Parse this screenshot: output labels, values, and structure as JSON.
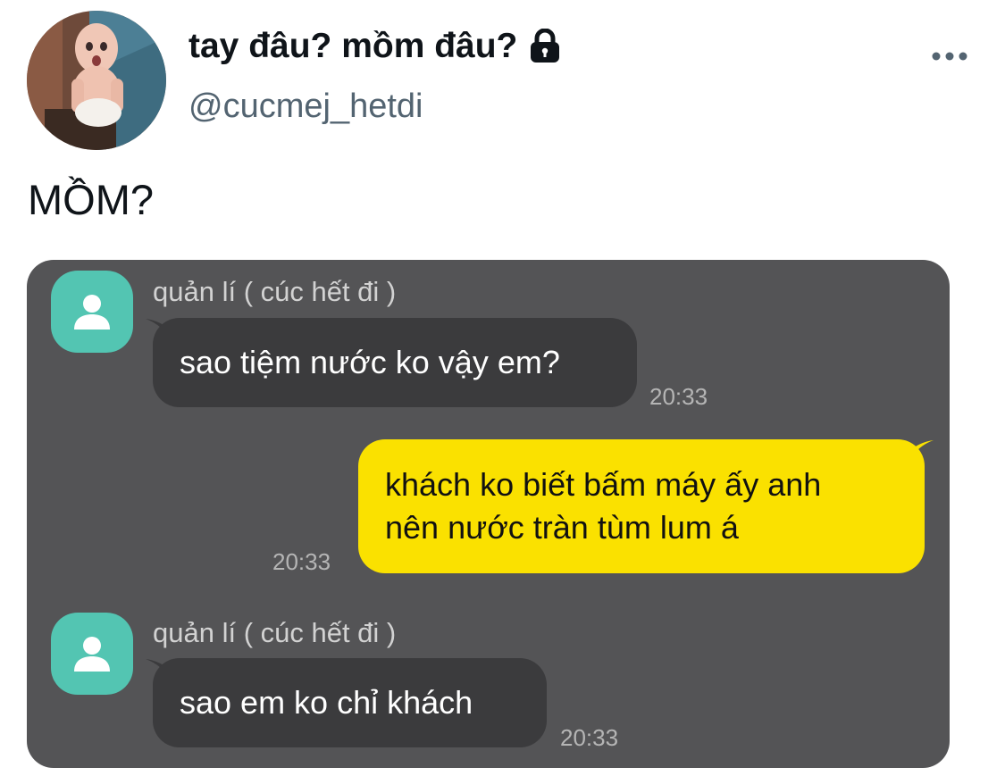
{
  "tweet": {
    "display_name": "tay đâu? mồm đâu?",
    "handle": "@cucmej_hetdi",
    "locked": true,
    "text": "MỒM?"
  },
  "icons": {
    "lock": "lock-icon",
    "more": "more-horizontal-icon",
    "avatar_placeholder": "person-icon"
  },
  "colors": {
    "chat_background": "#545456",
    "incoming_bubble": "#3b3b3d",
    "outgoing_bubble": "#fae100",
    "chat_avatar": "#53c5b2",
    "handle_text": "#536471"
  },
  "chat": {
    "messages": [
      {
        "sender": "quản lí ( cúc hết đi )",
        "direction": "incoming",
        "lines": [
          "sao tiệm nước ko vậy em?"
        ],
        "time": "20:33"
      },
      {
        "direction": "outgoing",
        "lines": [
          "khách ko biết bấm máy ấy anh",
          "nên nước tràn tùm lum á"
        ],
        "time": "20:33"
      },
      {
        "sender": "quản lí ( cúc hết đi )",
        "direction": "incoming",
        "lines": [
          "sao em ko chỉ khách"
        ],
        "time": "20:33"
      }
    ]
  }
}
